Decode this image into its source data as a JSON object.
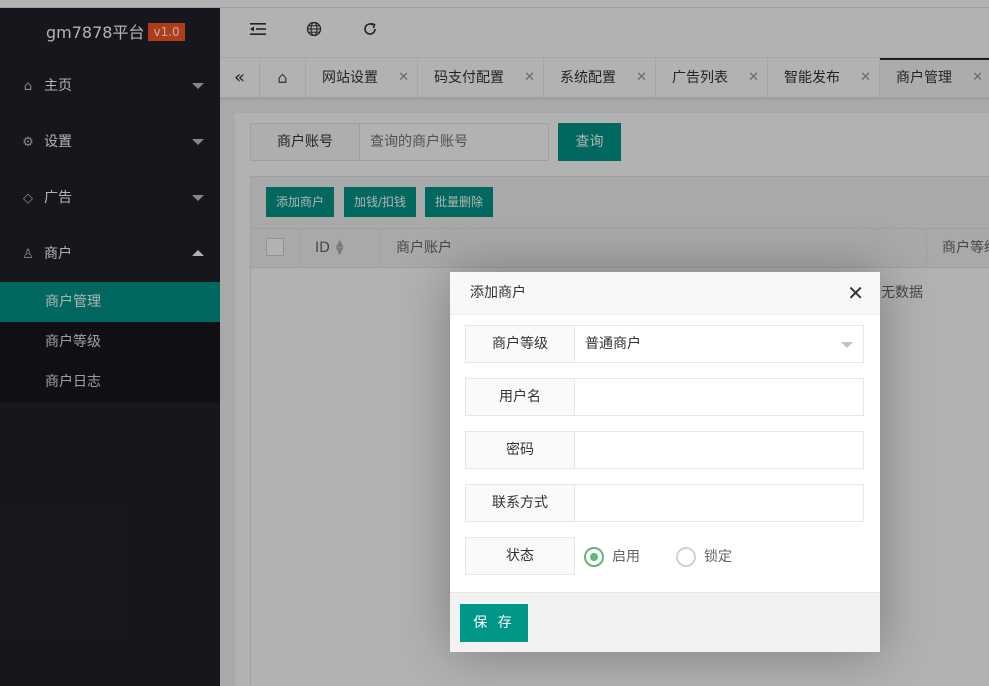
{
  "app": {
    "name": "gm7878平台",
    "version": "v1.0"
  },
  "colors": {
    "accent": "#009688",
    "sidebar_bg": "#20222a",
    "version_badge": "#ff5722",
    "radio_on": "#5fb878"
  },
  "sidebar": {
    "items": [
      {
        "label": "主页",
        "icon": "home-icon",
        "expanded": false
      },
      {
        "label": "设置",
        "icon": "gear-icon",
        "expanded": false
      },
      {
        "label": "广告",
        "icon": "diamond-icon",
        "expanded": false
      },
      {
        "label": "商户",
        "icon": "user-icon",
        "expanded": true
      }
    ],
    "sub_items": [
      {
        "label": "商户管理",
        "active": true
      },
      {
        "label": "商户等级",
        "active": false
      },
      {
        "label": "商户日志",
        "active": false
      }
    ]
  },
  "header": {
    "icons": [
      "menu-collapse-icon",
      "globe-icon",
      "refresh-icon"
    ]
  },
  "tabs": [
    {
      "label": "网站设置",
      "active": false
    },
    {
      "label": "码支付配置",
      "active": false
    },
    {
      "label": "系统配置",
      "active": false
    },
    {
      "label": "广告列表",
      "active": false
    },
    {
      "label": "智能发布",
      "active": false
    },
    {
      "label": "商户管理",
      "active": true
    }
  ],
  "search": {
    "label": "商户账号",
    "placeholder": "查询的商户账号",
    "button": "查询"
  },
  "toolbar": {
    "add": "添加商户",
    "money": "加钱/扣钱",
    "batch_delete": "批量删除"
  },
  "table": {
    "columns": [
      "ID",
      "商户账户",
      "商户等级"
    ],
    "empty_text": "无数据"
  },
  "modal": {
    "title": "添加商户",
    "fields": {
      "level_label": "商户等级",
      "level_value": "普通商户",
      "username_label": "用户名",
      "username_value": "",
      "password_label": "密码",
      "password_value": "",
      "contact_label": "联系方式",
      "contact_value": "",
      "status_label": "状态",
      "status_options": [
        "启用",
        "锁定"
      ],
      "status_selected": "启用"
    },
    "save_button": "保 存"
  }
}
